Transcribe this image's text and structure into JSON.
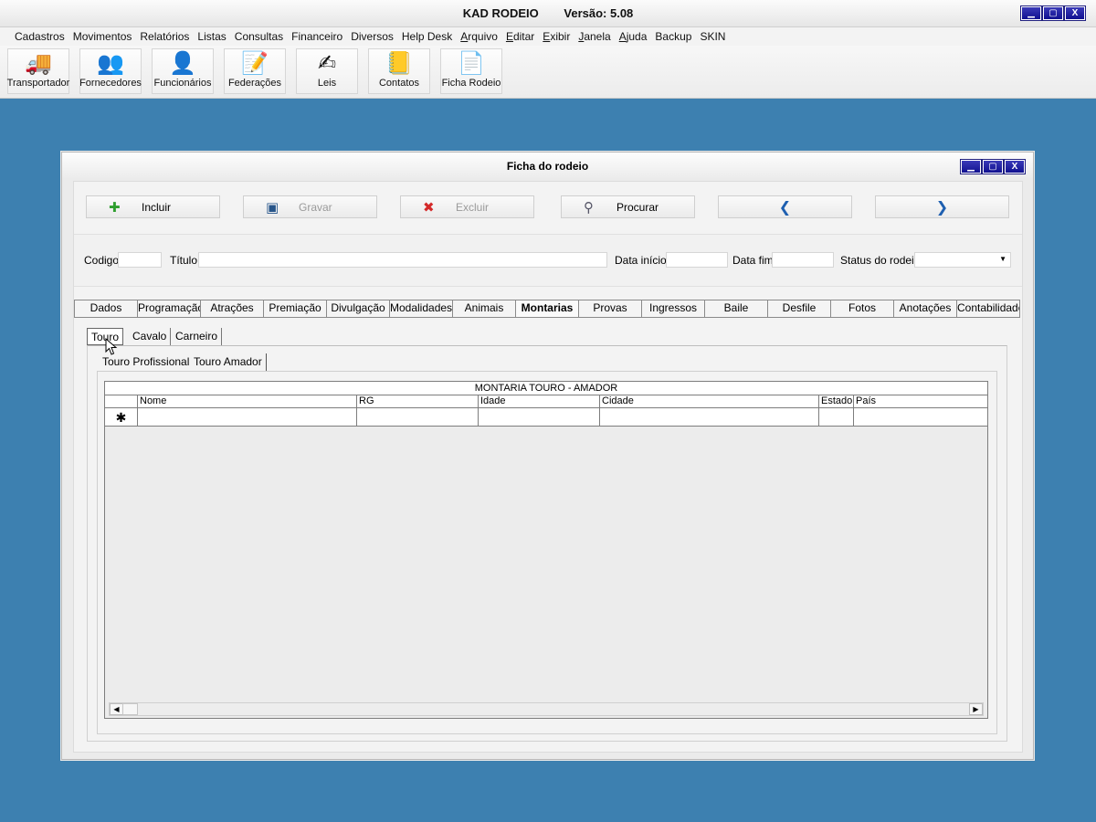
{
  "app": {
    "title": "KAD RODEIO",
    "version": "Versão: 5.08",
    "window_buttons": [
      "▁",
      "▢",
      "X"
    ]
  },
  "menu": [
    "Cadastros",
    "Movimentos",
    "Relatórios",
    "Listas",
    "Consultas",
    "Financeiro",
    "Diversos",
    "Help Desk",
    "Arquivo",
    "Editar",
    "Exibir",
    "Janela",
    "Ajuda",
    "Backup",
    "SKIN"
  ],
  "toolbar": [
    {
      "label": "Transportador",
      "icon": "truck-icon",
      "glyph": "🚚"
    },
    {
      "label": "Fornecedores",
      "icon": "suppliers-icon",
      "glyph": "👥"
    },
    {
      "label": "Funcionários",
      "icon": "employee-icon",
      "glyph": "👤"
    },
    {
      "label": "Federações",
      "icon": "document-pencil-icon",
      "glyph": "📝"
    },
    {
      "label": "Leis",
      "icon": "law-book-icon",
      "glyph": "✍"
    },
    {
      "label": "Contatos",
      "icon": "contacts-book-icon",
      "glyph": "📒"
    },
    {
      "label": "Ficha Rodeio",
      "icon": "rodeo-form-icon",
      "glyph": "📄"
    }
  ],
  "child_window": {
    "title": "Ficha do rodeio",
    "window_buttons": [
      "▁",
      "▢",
      "X"
    ],
    "actions": {
      "incluir": "Incluir",
      "gravar": "Gravar",
      "excluir": "Excluir",
      "procurar": "Procurar",
      "prev": "❮",
      "next": "❯"
    },
    "fields": {
      "codigo": "Codigo",
      "titulo": "Título",
      "data_inicio": "Data início",
      "data_fim": "Data fim",
      "status": "Status do rodeio"
    },
    "tabs": [
      "Dados",
      "Programação",
      "Atrações",
      "Premiação",
      "Divulgação",
      "Modalidades",
      "Animais",
      "Montarias",
      "Provas",
      "Ingressos",
      "Baile",
      "Desfile",
      "Fotos",
      "Anotações",
      "Contabilidade"
    ],
    "active_tab": "Montarias",
    "subtabs": [
      "Touro",
      "Cavalo",
      "Carneiro"
    ],
    "sub2tabs": [
      "Touro Profissional",
      "Touro Amador"
    ],
    "grid": {
      "caption": "MONTARIA TOURO - AMADOR",
      "columns": [
        "Nome",
        "RG",
        "Idade",
        "Cidade",
        "Estado",
        "País"
      ],
      "new_row_marker": "✱"
    }
  },
  "colors": {
    "desktop": "#3d80b0",
    "window_button": "#14149a",
    "nav_arrow": "#1e5fb0",
    "add_icon": "#2e9e2e",
    "delete_icon": "#d42a2a"
  }
}
